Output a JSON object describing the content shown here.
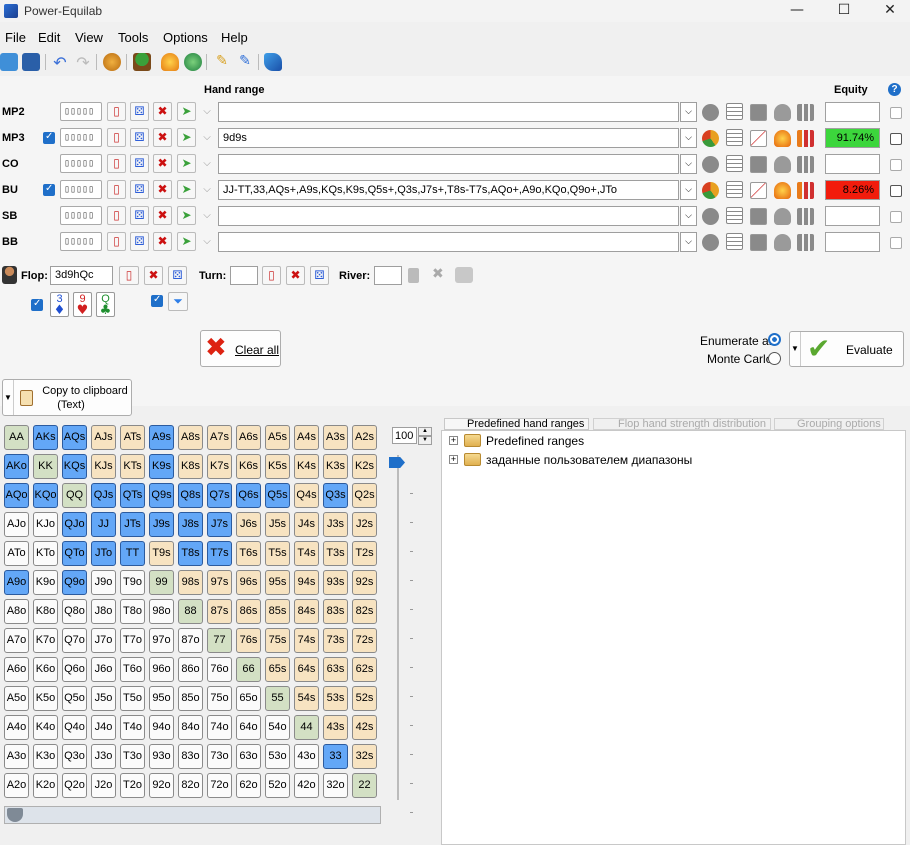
{
  "window": {
    "title": "Power-Equilab",
    "minimize": "—",
    "maximize": "☐",
    "close": "✕"
  },
  "menu": [
    "File",
    "Edit",
    "View",
    "Tools",
    "Options",
    "Help"
  ],
  "colors": {
    "selected_cell": "#63a7f7",
    "pair_cell": "#d3e0c4",
    "suited_cell": "#f7e3c1",
    "offsuit_cell": "#fbfbfb",
    "equity_high": "#3cd63c",
    "equity_low": "#f21c0c"
  },
  "headers": {
    "hand_range": "Hand range",
    "equity": "Equity",
    "help": "?"
  },
  "players": [
    {
      "label": "MP2",
      "checked": false,
      "range": "",
      "equity": ""
    },
    {
      "label": "MP3",
      "checked": true,
      "range": "9d9s",
      "equity": "91.74%"
    },
    {
      "label": "CO",
      "checked": false,
      "range": "",
      "equity": ""
    },
    {
      "label": "BU",
      "checked": true,
      "range": "JJ-TT,33,AQs+,A9s,KQs,K9s,Q5s+,Q3s,J7s+,T8s-T7s,AQo+,A9o,KQo,Q9o+,JTo",
      "equity": "8.26%"
    },
    {
      "label": "SB",
      "checked": false,
      "range": "",
      "equity": ""
    },
    {
      "label": "BB",
      "checked": false,
      "range": "",
      "equity": ""
    }
  ],
  "board": {
    "flop_label": "Flop:",
    "flop_value": "3d9hQc",
    "turn_label": "Turn:",
    "turn_value": "",
    "river_label": "River:",
    "river_value": "",
    "flop_cards": [
      {
        "rank": "3",
        "suit": "♦",
        "color": "#1f4fd1"
      },
      {
        "rank": "9",
        "suit": "♥",
        "color": "#d11f1f"
      },
      {
        "rank": "Q",
        "suit": "♣",
        "color": "#1f8f2f"
      }
    ]
  },
  "actions": {
    "clear_all": "Clear all",
    "enumerate_all": "Enumerate all",
    "monte_carlo": "Monte Carlo",
    "evaluate": "Evaluate",
    "copy_line1": "Copy to clipboard",
    "copy_line2": "(Text)"
  },
  "slider_value": "100",
  "tabs": [
    "Predefined hand ranges",
    "Flop hand strength distribution",
    "Grouping options"
  ],
  "tree": [
    "Predefined ranges",
    "заданные пользователем диапазоны"
  ],
  "grid": {
    "ranks": [
      "A",
      "K",
      "Q",
      "J",
      "T",
      "9",
      "8",
      "7",
      "6",
      "5",
      "4",
      "3",
      "2"
    ],
    "selected": [
      "AKs",
      "AQs",
      "A9s",
      "AKo",
      "KQs",
      "K9s",
      "AQo",
      "KQo",
      "QJs",
      "QTs",
      "Q9s",
      "Q8s",
      "Q7s",
      "Q6s",
      "Q5s",
      "Q3s",
      "QJo",
      "JJ",
      "JTs",
      "J9s",
      "J8s",
      "J7s",
      "QTo",
      "JTo",
      "TT",
      "T8s",
      "T7s",
      "A9o",
      "Q9o",
      "33"
    ]
  }
}
